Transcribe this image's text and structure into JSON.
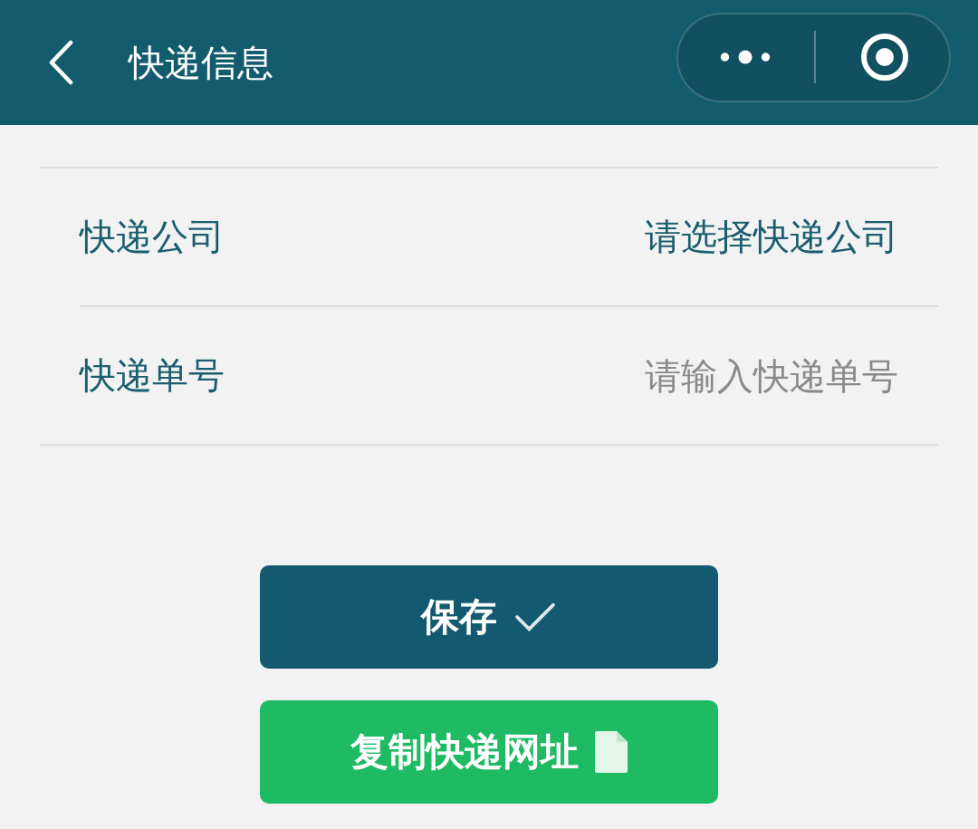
{
  "header": {
    "title": "快递信息"
  },
  "form": [
    {
      "kind": "picker",
      "label": "快递公司",
      "value": "请选择快递公司"
    },
    {
      "kind": "input",
      "label": "快递单号",
      "placeholder": "请输入快递单号"
    }
  ],
  "buttons": [
    {
      "kind": "primary",
      "label": "保存"
    },
    {
      "kind": "success",
      "label": "复制快递网址"
    }
  ]
}
